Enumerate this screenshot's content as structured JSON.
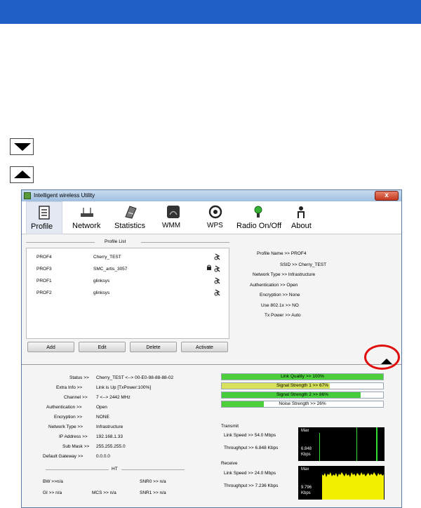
{
  "window": {
    "title": "Intelligent wireless Utility",
    "close_glyph": "x"
  },
  "toolbar": [
    {
      "label": "Profile",
      "icon": "profile-icon"
    },
    {
      "label": "Network",
      "icon": "network-icon"
    },
    {
      "label": "Statistics",
      "icon": "statistics-icon"
    },
    {
      "label": "WMM",
      "icon": "wmm-icon"
    },
    {
      "label": "WPS",
      "icon": "wps-icon"
    },
    {
      "label": "Radio On/Off",
      "icon": "radio-icon"
    },
    {
      "label": "About",
      "icon": "about-icon"
    }
  ],
  "profile_list": {
    "title": "Profile List",
    "rows": [
      {
        "name": "PROF4",
        "ssid": "Cherry_TEST"
      },
      {
        "name": "PROF3",
        "ssid": "SMC_artis_3057"
      },
      {
        "name": "PROF1",
        "ssid": "glinksys"
      },
      {
        "name": "PROF2",
        "ssid": "glinksys"
      }
    ],
    "buttons": {
      "add": "Add",
      "edit": "Edit",
      "delete": "Delete",
      "activate": "Activate"
    }
  },
  "profile_details": [
    {
      "label": "Profile Name >> ",
      "value": "PROF4"
    },
    {
      "label": "SSID >> ",
      "value": "Cherry_TEST"
    },
    {
      "label": "Network Type >> ",
      "value": "Infrastructure"
    },
    {
      "label": "Authentication >> ",
      "value": "Open"
    },
    {
      "label": "Encryption >> ",
      "value": "None"
    },
    {
      "label": "Use 802.1x >> ",
      "value": "NO"
    },
    {
      "label": "Tx Power >> ",
      "value": "Auto"
    }
  ],
  "status": [
    {
      "label": "Status >>",
      "value": "Cherry_TEST <--> 00-E0-98-88-88-02"
    },
    {
      "label": "Extra Info >>",
      "value": "Link is Up [TxPower:100%]"
    },
    {
      "label": "Channel >>",
      "value": "7 <--> 2442 MHz"
    },
    {
      "label": "Authentication >>",
      "value": "Open"
    },
    {
      "label": "Encryption >>",
      "value": "NONE"
    },
    {
      "label": "Network Type >>",
      "value": "Infrastructure"
    },
    {
      "label": "IP Address >>",
      "value": "192.168.1.33"
    },
    {
      "label": "Sub Mask >>",
      "value": "255.255.255.0"
    },
    {
      "label": "Default Gateway >>",
      "value": "0.0.0.0"
    }
  ],
  "ht": {
    "title": "HT",
    "bw": "BW >>n/a",
    "gi": "GI >> n/a",
    "mcs": "MCS >>  n/a",
    "snr0": "SNR0 >>  n/a",
    "snr1": "SNR1 >>  n/a"
  },
  "bars": [
    {
      "label": "Link Quality >> 100%",
      "value": 1.0,
      "color": "#4ccf3a"
    },
    {
      "label": "Signal Strength 1 >> 67%",
      "value": 0.67,
      "color": "#d8e15a"
    },
    {
      "label": "Signal Strength 2 >> 86%",
      "value": 0.86,
      "color": "#45cc3a"
    },
    {
      "label": "Noise Strength >> 26%",
      "value": 0.26,
      "color": "#4ccf3a"
    }
  ],
  "transmit": {
    "title": "Transmit",
    "link_speed": "Link Speed >> 54.0 Mbps",
    "throughput": "Throughput >> 6.848 Kbps",
    "graph_max": "Max",
    "graph_value": "6.848",
    "graph_unit": "Kbps",
    "line_color": "#33dd33"
  },
  "receive": {
    "title": "Receive",
    "link_speed": "Link Speed >> 24.0 Mbps",
    "throughput": "Throughput >> 7.236 Kbps",
    "graph_max": "Max",
    "graph_value": "9.796",
    "graph_unit": "Kbps",
    "fill_color": "#f2f000"
  },
  "colors": {
    "header_bar": "#1f5fc6",
    "highlight_ring": "#e10e0e"
  }
}
